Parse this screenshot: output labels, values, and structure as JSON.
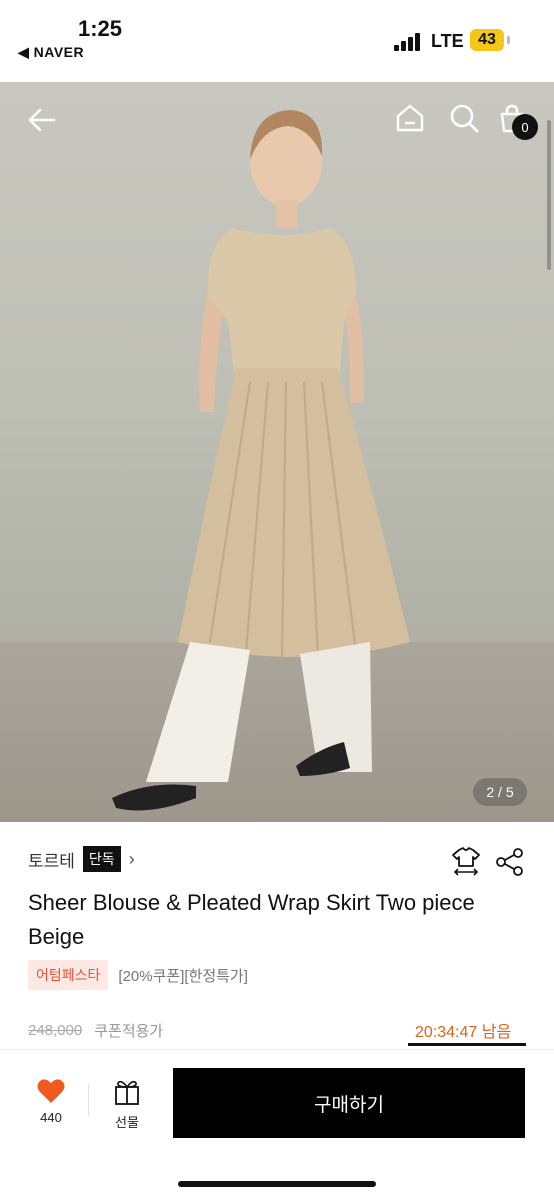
{
  "status_bar": {
    "time": "1:25",
    "back_app": "◀ NAVER",
    "network": "LTE",
    "battery": "43"
  },
  "hero": {
    "cart_count": "0",
    "page_indicator": "2 / 5"
  },
  "product": {
    "brand": "토르테",
    "exclusive_badge": "단독",
    "title": "Sheer Blouse & Pleated Wrap Skirt Two piece Beige",
    "promo_badge": "어텀페스타",
    "promo_text": "[20%쿠폰][한정특가]",
    "original_price": "248,000",
    "coupon_price_label": "쿠폰적용가",
    "timer": "20:34:47 남음"
  },
  "bottom_bar": {
    "like_count": "440",
    "gift_label": "선물",
    "buy_label": "구매하기"
  },
  "colors": {
    "accent": "#e8543a",
    "timer": "#d9641a",
    "buy_button": "#000000",
    "heart": "#f05a1e"
  }
}
